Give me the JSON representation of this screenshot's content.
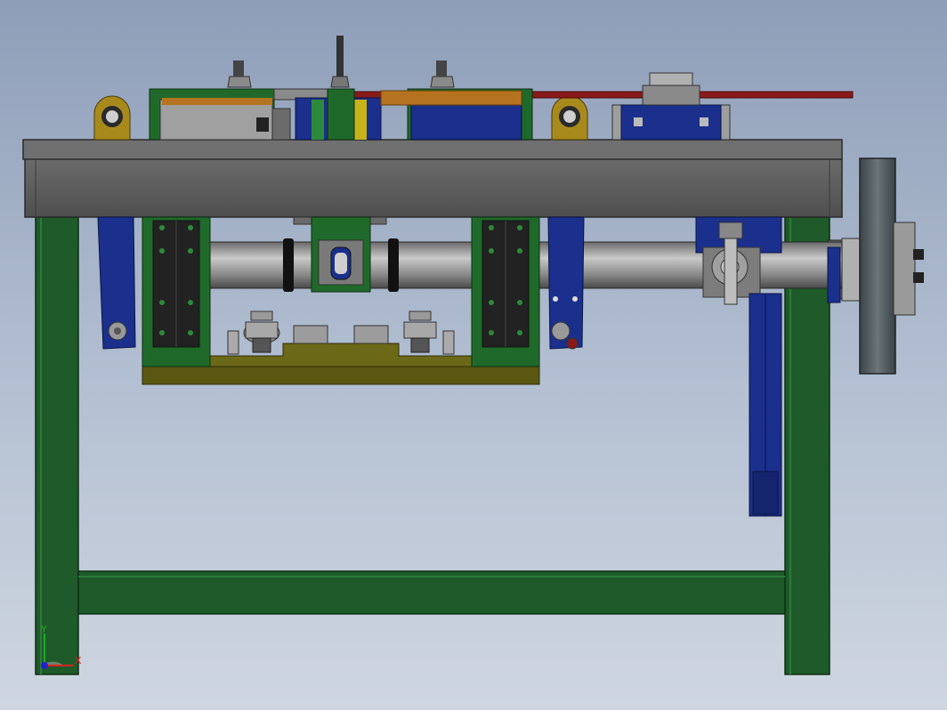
{
  "view": {
    "axis_triad": {
      "x_label": "X",
      "y_label": "Y"
    }
  },
  "colors": {
    "background_top": "#8e9eb8",
    "background_bottom": "#cfd6e0",
    "frame_green": "#1f5a2a",
    "frame_green_dark": "#123a18",
    "table_grey": "#5a5a5a",
    "table_top": "#6e6e6e",
    "blue_part": "#1b2f8c",
    "olive_base": "#5a5712",
    "shaft_grey": "#8f8f8f",
    "bronze": "#b5731f",
    "red_rod": "#8a1a1a",
    "yellow_lug": "#a88a1c",
    "flywheel": "#4a5458",
    "axis_x": "#d22",
    "axis_y": "#2a2",
    "axis_z": "#22c"
  }
}
